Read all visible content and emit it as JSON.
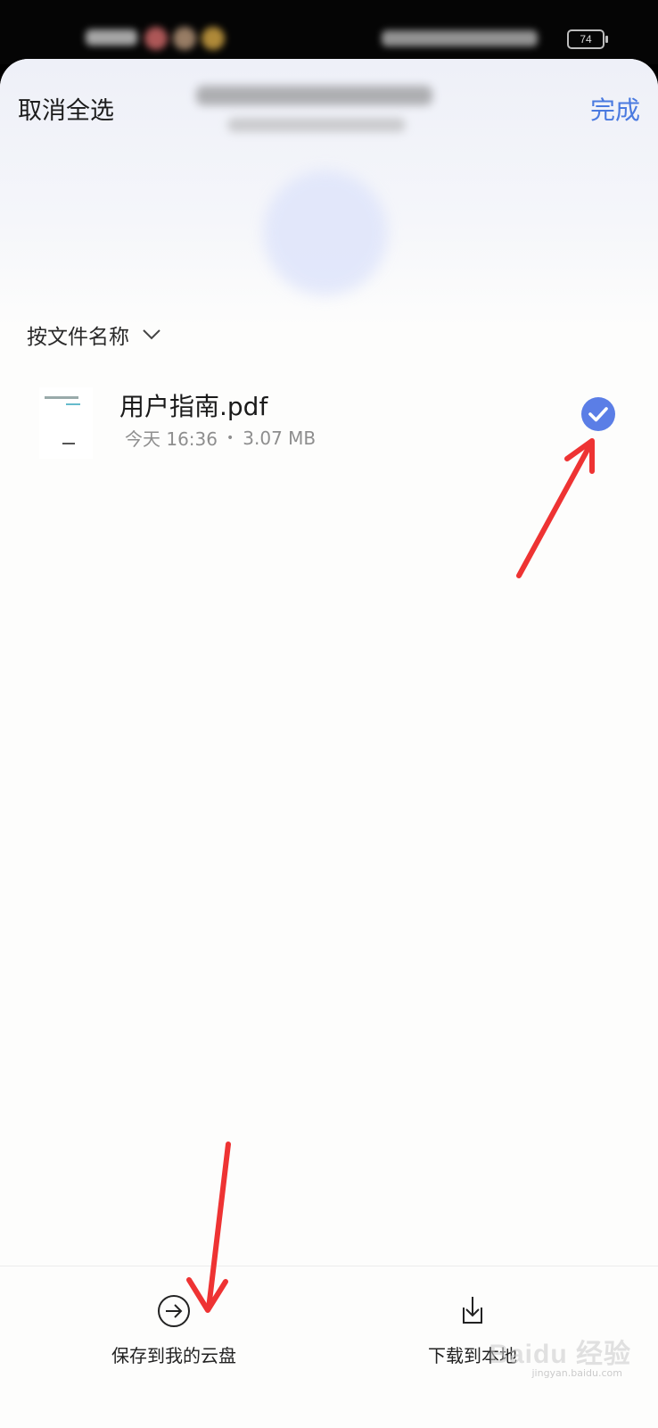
{
  "status_bar": {
    "battery": "74"
  },
  "header": {
    "cancel_select_label": "取消全选",
    "done_label": "完成"
  },
  "sort": {
    "label": "按文件名称"
  },
  "files": [
    {
      "name": "用户指南.pdf",
      "date": "今天 16:36",
      "separator": "•",
      "size": "3.07 MB",
      "selected": true
    }
  ],
  "actions": {
    "save_label": "保存到我的云盘",
    "download_label": "下载到本地"
  },
  "watermark": {
    "brand": "Baidu 经验",
    "url": "jingyan.baidu.com"
  },
  "colors": {
    "accent": "#4a7ae0",
    "check_bg": "#5b7ee6",
    "annotation_arrow": "#ee3333"
  }
}
